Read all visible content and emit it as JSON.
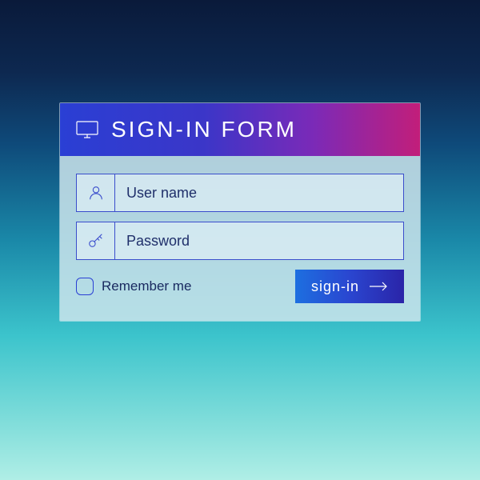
{
  "header": {
    "title": "SIGN-IN FORM",
    "icon": "monitor-icon"
  },
  "fields": {
    "username": {
      "placeholder": "User name",
      "value": "",
      "icon": "user-icon"
    },
    "password": {
      "placeholder": "Password",
      "value": "",
      "icon": "key-icon"
    }
  },
  "remember": {
    "label": "Remember me",
    "checked": false
  },
  "submit": {
    "label": "sign-in",
    "icon": "arrow-right-icon"
  },
  "colors": {
    "accent": "#2a3fd4",
    "gradient_start": "#1d6fe0",
    "gradient_end": "#2a24a8",
    "header_start": "#2a3fd4",
    "header_end": "#c21e7a"
  }
}
